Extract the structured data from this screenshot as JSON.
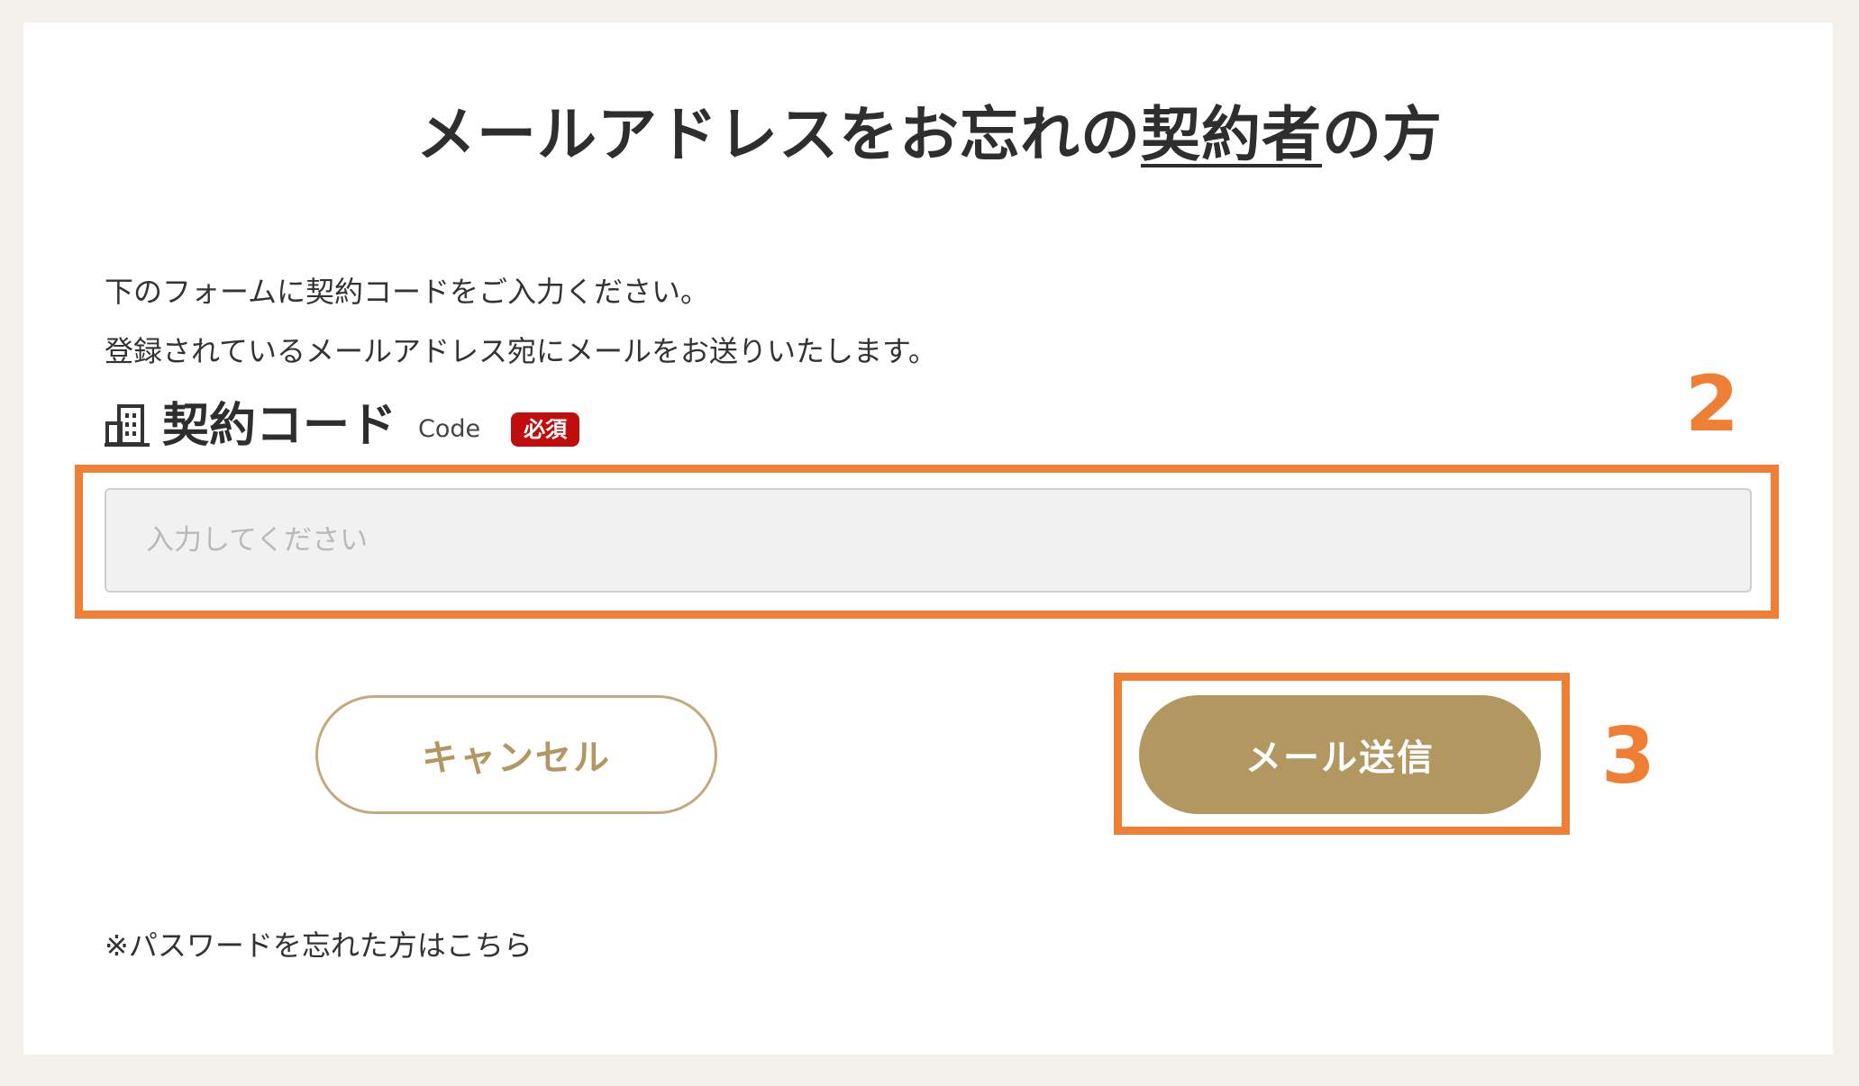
{
  "page": {
    "title_pre": "メールアドレスをお忘れの",
    "title_underlined": "契約者",
    "title_post": "の方",
    "description_line1": "下のフォームに契約コードをご入力ください。",
    "description_line2": "登録されているメールアドレス宛にメールをお送りいたします。"
  },
  "form": {
    "field_icon": "building-icon",
    "field_label": "契約コード",
    "field_sublabel": "Code",
    "required_badge": "必須",
    "input_value": "",
    "input_placeholder": "入力してください"
  },
  "buttons": {
    "cancel_label": "キャンセル",
    "send_label": "メール送信"
  },
  "annotations": {
    "step_input": "2",
    "step_send": "3",
    "highlight_color": "#ee7f35"
  },
  "links": {
    "forgot_password": "※パスワードを忘れた方はこちら"
  },
  "colors": {
    "background": "#f4f1ec",
    "card": "#ffffff",
    "accent_gold": "#b29761",
    "required_red": "#c00d0d"
  }
}
